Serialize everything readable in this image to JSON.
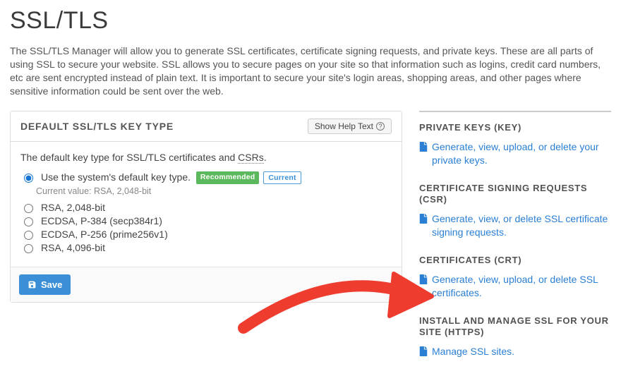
{
  "page": {
    "title": "SSL/TLS",
    "description": "The SSL/TLS Manager will allow you to generate SSL certificates, certificate signing requests, and private keys. These are all parts of using SSL to secure your website. SSL allows you to secure pages on your site so that information such as logins, credit card numbers, etc are sent encrypted instead of plain text. It is important to secure your site's login areas, shopping areas, and other pages where sensitive information could be sent over the web."
  },
  "card": {
    "heading": "DEFAULT SSL/TLS KEY TYPE",
    "help_label": "Show Help Text",
    "intro_prefix": "The default key type for SSL/TLS certificates and ",
    "intro_abbr": "CSRs",
    "intro_suffix": ".",
    "current_value_label": "Current value: RSA, 2,048-bit",
    "badges": {
      "recommended": "Recommended",
      "current": "Current"
    },
    "options": [
      {
        "label": "Use the system's default key type.",
        "selected": true
      },
      {
        "label": "RSA, 2,048-bit",
        "selected": false
      },
      {
        "label": "ECDSA, P-384 (secp384r1)",
        "selected": false
      },
      {
        "label": "ECDSA, P-256 (prime256v1)",
        "selected": false
      },
      {
        "label": "RSA, 4,096-bit",
        "selected": false
      }
    ],
    "save_label": "Save"
  },
  "sidebar": {
    "sections": [
      {
        "heading": "PRIVATE KEYS (KEY)",
        "link": "Generate, view, upload, or delete your private keys."
      },
      {
        "heading": "CERTIFICATE SIGNING REQUESTS (CSR)",
        "link": "Generate, view, or delete SSL certificate signing requests."
      },
      {
        "heading": "CERTIFICATES (CRT)",
        "link": "Generate, view, upload, or delete SSL certificates."
      },
      {
        "heading": "INSTALL AND MANAGE SSL FOR YOUR SITE (HTTPS)",
        "link": "Manage SSL sites."
      }
    ]
  },
  "colors": {
    "accent": "#3b8fd6",
    "link": "#2a7fd4",
    "green": "#5cb85c",
    "annotation": "#ee3c2f"
  }
}
